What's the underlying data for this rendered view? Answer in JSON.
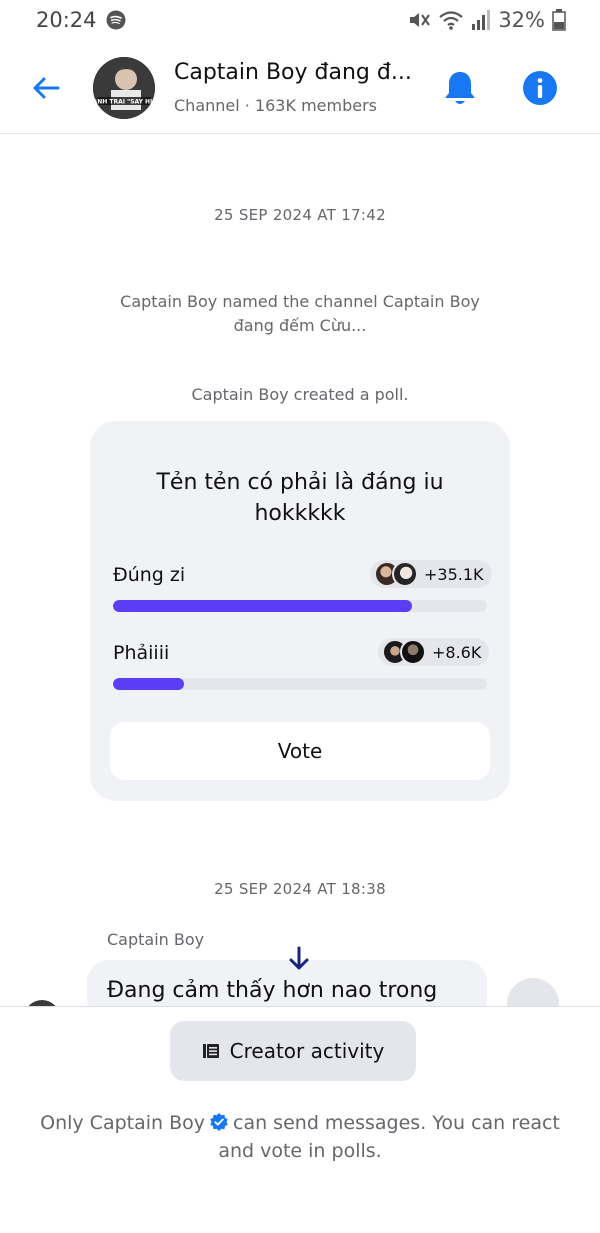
{
  "status_bar": {
    "time": "20:24",
    "battery": "32%"
  },
  "header": {
    "title": "Captain Boy đang đ...",
    "subtitle": "Channel · 163K members",
    "avatar_text": "ANH TRAI \"SAY HI\""
  },
  "timeline": {
    "timestamp_1": "25 SEP 2024 AT 17:42",
    "rename_message": "Captain Boy named the channel Captain Boy đang đếm Cừu...",
    "poll_created": "Captain Boy created a poll.",
    "timestamp_2": "25 SEP 2024 AT 18:38"
  },
  "poll": {
    "question": "Tẻn tẻn có phải là đáng iu hokkkkk",
    "options": [
      {
        "label": "Đúng zi",
        "votes": "+35.1K",
        "share": 0.8
      },
      {
        "label": "Phảiiii",
        "votes": "+8.6K",
        "share": 0.19
      }
    ],
    "vote_label": "Vote"
  },
  "message": {
    "sender": "Captain Boy",
    "text": "Đang cảm thấy hơn nao trong"
  },
  "footer": {
    "creator_activity_label": "Creator activity",
    "note_before": "Only Captain Boy",
    "note_after": "can send messages. You can react and vote in polls."
  },
  "colors": {
    "accent": "#1877f2",
    "poll_bar": "#5b3df5",
    "muted_text": "#65676b",
    "card_bg": "#f0f2f5"
  }
}
